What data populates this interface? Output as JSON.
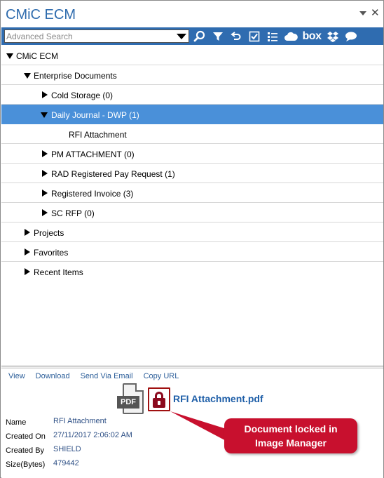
{
  "window": {
    "title": "CMiC ECM",
    "menu_icon": "dropdown-arrow",
    "close_label": "✕"
  },
  "toolbar": {
    "search_placeholder": "Advanced Search",
    "icons": [
      "search-icon",
      "filter-icon",
      "undo-icon",
      "checkbox-icon",
      "list-icon",
      "cloud-icon",
      "box-icon",
      "dropbox-icon",
      "chat-icon"
    ],
    "box_label": "box",
    "background": "#2f6cb0"
  },
  "tree": {
    "selected_color": "#4a90d9",
    "items": [
      {
        "label": "CMiC ECM",
        "level": 0,
        "expanded": true,
        "has_arrow": true
      },
      {
        "label": "Enterprise Documents",
        "level": 1,
        "expanded": true,
        "has_arrow": true
      },
      {
        "label": "Cold Storage (0)",
        "level": 2,
        "expanded": false,
        "has_arrow": true
      },
      {
        "label": "Daily Journal - DWP (1)",
        "level": 2,
        "expanded": true,
        "has_arrow": true,
        "selected": true
      },
      {
        "label": "RFI Attachment",
        "level": 3,
        "expanded": false,
        "has_arrow": false
      },
      {
        "label": "PM ATTACHMENT (0)",
        "level": 2,
        "expanded": false,
        "has_arrow": true
      },
      {
        "label": "RAD Registered Pay Request (1)",
        "level": 2,
        "expanded": false,
        "has_arrow": true
      },
      {
        "label": "Registered Invoice (3)",
        "level": 2,
        "expanded": false,
        "has_arrow": true
      },
      {
        "label": "SC RFP (0)",
        "level": 2,
        "expanded": false,
        "has_arrow": true
      },
      {
        "label": "Projects",
        "level": 1,
        "expanded": false,
        "has_arrow": true
      },
      {
        "label": "Favorites",
        "level": 1,
        "expanded": false,
        "has_arrow": true
      },
      {
        "label": "Recent Items",
        "level": 1,
        "expanded": false,
        "has_arrow": true
      }
    ]
  },
  "details": {
    "actions": [
      "View",
      "Download",
      "Send Via Email",
      "Copy URL"
    ],
    "pdf_label": "PDF",
    "file_name": "RFI Attachment.pdf",
    "properties": [
      {
        "label": "Name",
        "value": "RFI Attachment"
      },
      {
        "label": "Created On",
        "value": "27/11/2017 2:06:02 AM"
      },
      {
        "label": "Created By",
        "value": "SHIELD"
      },
      {
        "label": "Size(Bytes)",
        "value": "479442"
      }
    ]
  },
  "callout": {
    "line1": "Document locked in",
    "line2": "Image Manager",
    "color": "#c8102e"
  }
}
